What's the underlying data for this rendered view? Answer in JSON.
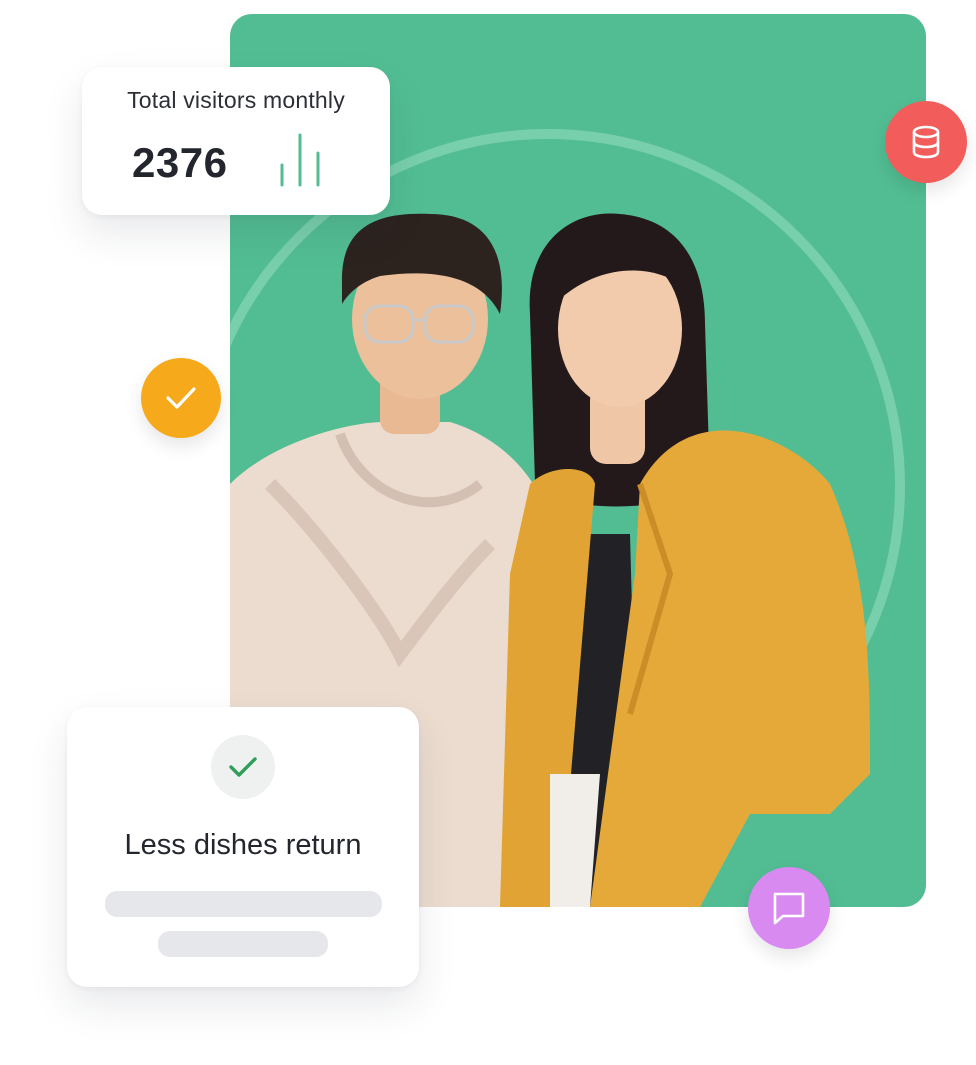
{
  "visitors_card": {
    "title": "Total visitors monthly",
    "count": "2376",
    "mini_chart_icon": "bar-chart-icon"
  },
  "dishes_card": {
    "icon": "check-icon",
    "title": "Less dishes return"
  },
  "bubbles": {
    "check": {
      "icon": "check-icon",
      "color": "#f6a91a"
    },
    "database": {
      "icon": "database-icon",
      "color": "#f25c5a"
    },
    "chat": {
      "icon": "chat-icon",
      "color": "#d88af0"
    }
  },
  "hero": {
    "background_color": "#52bd93",
    "image": "photo-two-people"
  }
}
